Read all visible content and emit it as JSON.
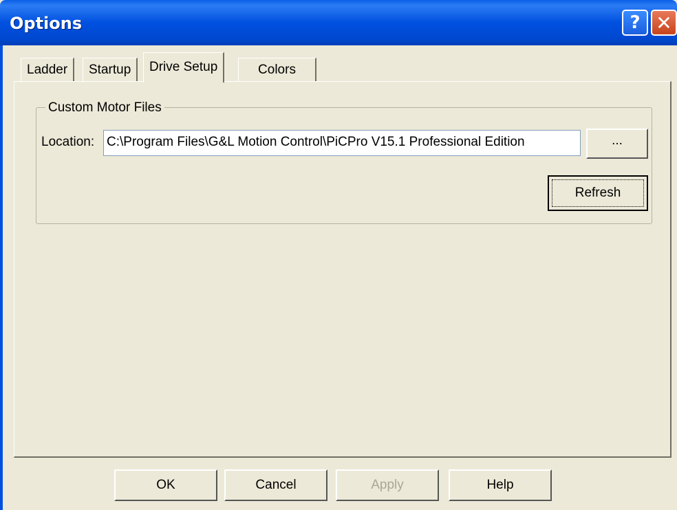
{
  "window": {
    "title": "Options",
    "help_glyph": "?",
    "close_glyph": "✕"
  },
  "tabs": [
    {
      "label": "Ladder",
      "active": false
    },
    {
      "label": "Startup",
      "active": false
    },
    {
      "label": "Drive Setup",
      "active": true
    },
    {
      "label": "Colors",
      "active": false
    }
  ],
  "drive_setup": {
    "group_title": "Custom Motor Files",
    "location_label": "Location:",
    "location_value": "C:\\Program Files\\G&L Motion Control\\PiCPro V15.1 Professional Edition",
    "browse_label": "...",
    "refresh_label": "Refresh"
  },
  "footer": {
    "ok_label": "OK",
    "cancel_label": "Cancel",
    "apply_label": "Apply",
    "help_label": "Help"
  }
}
